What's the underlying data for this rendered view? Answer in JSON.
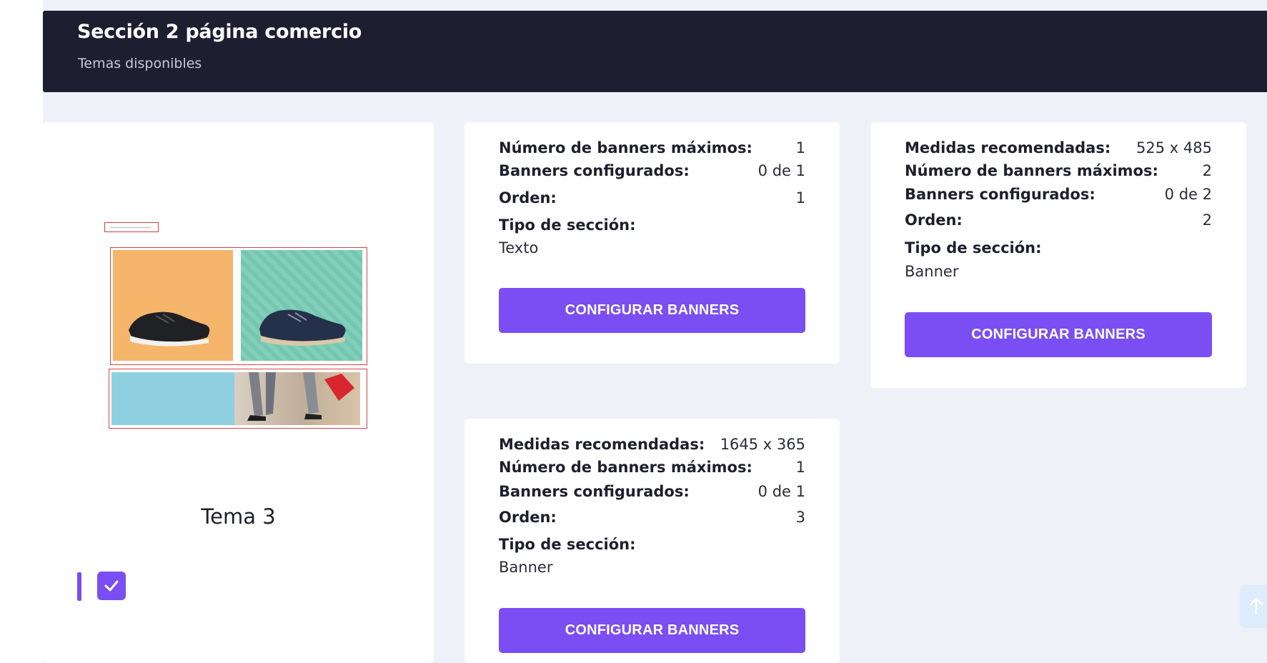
{
  "header": {
    "title": "Sección 2 página comercio",
    "subtitle": "Temas disponibles"
  },
  "theme": {
    "name": "Tema 3",
    "selected": true
  },
  "sections": [
    {
      "max_banners_label": "Número de banners máximos:",
      "max_banners_value": "1",
      "configured_label": "Banners configurados:",
      "configured_value": "0 de 1",
      "order_label": "Orden:",
      "order_value": "1",
      "type_label": "Tipo de sección:",
      "type_value": "Texto",
      "button_label": "CONFIGURAR BANNERS"
    },
    {
      "sizes_label": "Medidas recomendadas:",
      "sizes_value": "1645 x 365",
      "max_banners_label": "Número de banners máximos:",
      "max_banners_value": "1",
      "configured_label": "Banners configurados:",
      "configured_value": "0 de 1",
      "order_label": "Orden:",
      "order_value": "3",
      "type_label": "Tipo de sección:",
      "type_value": "Banner",
      "button_label": "CONFIGURAR BANNERS"
    },
    {
      "sizes_label": "Medidas recomendadas:",
      "sizes_value": "525 x 485",
      "max_banners_label": "Número de banners máximos:",
      "max_banners_value": "2",
      "configured_label": "Banners configurados:",
      "configured_value": "0 de 2",
      "order_label": "Orden:",
      "order_value": "2",
      "type_label": "Tipo de sección:",
      "type_value": "Banner",
      "button_label": "CONFIGURAR BANNERS"
    }
  ],
  "icons": {
    "checkbox": "check-icon",
    "scroll_top": "arrow-up-icon"
  },
  "colors": {
    "header_bg": "#1d1e30",
    "accent": "#7a4ef2",
    "page_bg": "#eef1f7"
  }
}
